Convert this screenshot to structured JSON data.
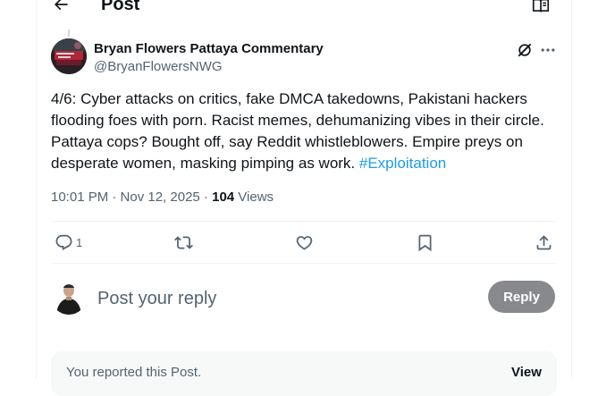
{
  "header": {
    "title": "Post",
    "back_icon": "arrow-left-icon",
    "reader_icon": "reader-book-icon"
  },
  "post": {
    "author_name": "Bryan Flowers Pattaya Commentary",
    "author_handle": "@BryanFlowersNWG",
    "text": "4/6: Cyber attacks on critics, fake DMCA takedowns, Pakistani hackers flooding foes with porn. Racist memes, dehumanizing vibes in their circle. Pattaya cops? Bought off, say Reddit whistleblowers. Empire preys on desperate women, masking pimping as work. ",
    "hashtag": "#Exploitation",
    "timestamp": "10:01 PM · Nov 12, 2025",
    "separator": " · ",
    "views_count": "104",
    "views_label": " Views"
  },
  "actions": {
    "reply_count": "1",
    "icons": [
      "reply-icon",
      "repost-icon",
      "like-icon",
      "bookmark-icon",
      "share-icon"
    ]
  },
  "composer": {
    "placeholder": "Post your reply",
    "reply_label": "Reply"
  },
  "report_notice": {
    "text": "You reported this Post.",
    "view_label": "View"
  },
  "colors": {
    "accent": "#1d9bf0",
    "text_primary": "#0f1419",
    "text_secondary": "#536471",
    "border": "#eff3f4",
    "disabled_button": "#87898c"
  }
}
